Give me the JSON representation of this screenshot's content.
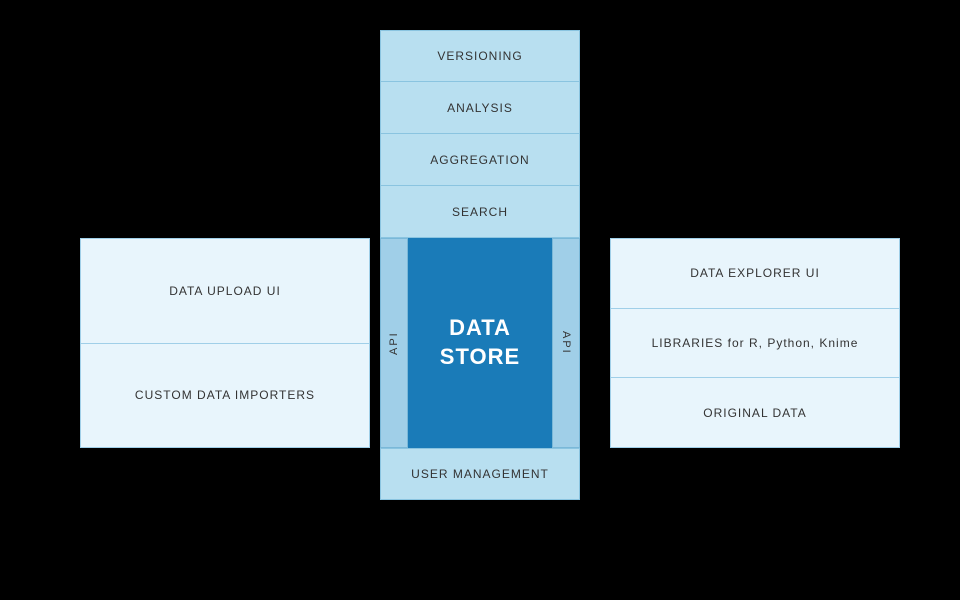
{
  "diagram": {
    "top_boxes": [
      {
        "label": "VERSIONING"
      },
      {
        "label": "ANALYSIS"
      },
      {
        "label": "AGGREGATION"
      },
      {
        "label": "SEARCH"
      }
    ],
    "api_left": "API",
    "api_right": "API",
    "data_store": "DATA\nSTORE",
    "bottom_box": "USER MANAGEMENT",
    "left_boxes": [
      {
        "label": "DATA UPLOAD UI"
      },
      {
        "label": "CUSTOM DATA IMPORTERS"
      }
    ],
    "right_boxes": [
      {
        "label": "DATA EXPLORER UI"
      },
      {
        "label": "LIBRARIES for R, Python, Knime"
      },
      {
        "label": "ORIGINAL DATA"
      }
    ]
  }
}
